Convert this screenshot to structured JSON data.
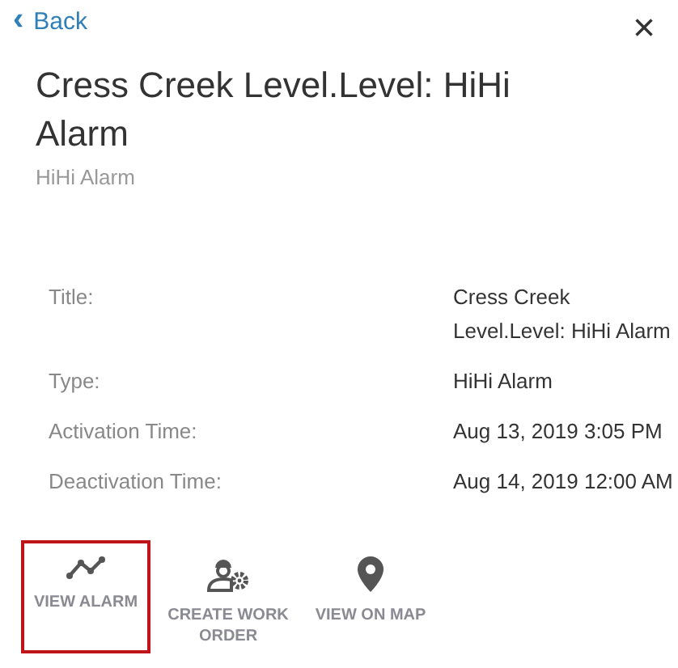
{
  "back": {
    "icon": "‹",
    "label": "Back"
  },
  "close": "×",
  "title": "Cress Creek Level.Level: HiHi Alarm",
  "subtitle": "HiHi Alarm",
  "details": [
    {
      "label": "Title:",
      "value": "Cress Creek Level.Level: HiHi Alarm"
    },
    {
      "label": "Type:",
      "value": "HiHi Alarm"
    },
    {
      "label": "Activation Time:",
      "value": "Aug 13, 2019 3:05 PM"
    },
    {
      "label": "Deactivation Time:",
      "value": "Aug 14, 2019 12:00 AM"
    }
  ],
  "actions": [
    {
      "kind": "chart",
      "label": "VIEW ALARM",
      "selected": true
    },
    {
      "kind": "worker",
      "label": "CREATE WORK ORDER",
      "selected": false
    },
    {
      "kind": "pin",
      "label": "VIEW ON MAP",
      "selected": false
    }
  ]
}
